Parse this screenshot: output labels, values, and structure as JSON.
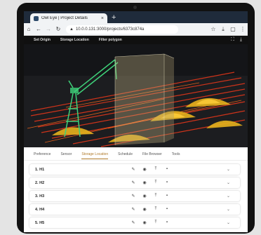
{
  "browser": {
    "tab_title": "Owl Eye | Project Details",
    "tab_close": "×",
    "new_tab": "+",
    "url": "10.0.0.131:3000/projects/6373c874a",
    "icons": [
      "home-icon",
      "back-icon",
      "forward-icon",
      "reload-icon",
      "star-icon",
      "download-icon",
      "tab-count-icon",
      "menu-icon"
    ]
  },
  "app_nav": {
    "items": [
      "Set Origin",
      "Storage Location",
      "Filter polygon"
    ]
  },
  "sub_tabs": {
    "items": [
      "Preference",
      "Sensor",
      "Storage Location",
      "Schedule",
      "File Browser",
      "Tools"
    ],
    "active": "Storage Location",
    "accent_color": "#b07a2a"
  },
  "locations": [
    {
      "label": "1. H1"
    },
    {
      "label": "2. H2"
    },
    {
      "label": "3. H3"
    },
    {
      "label": "4. H4"
    },
    {
      "label": "5. H5"
    }
  ]
}
